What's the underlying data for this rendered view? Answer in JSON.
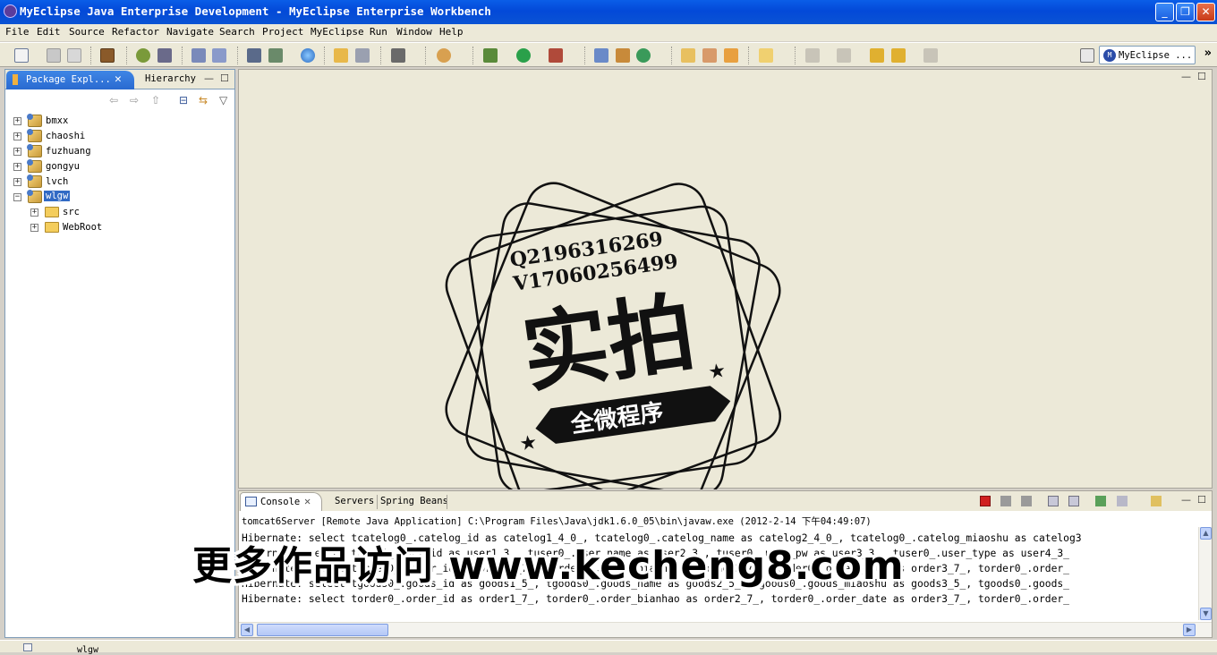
{
  "window": {
    "title": "MyEclipse Java Enterprise Development - MyEclipse Enterprise Workbench",
    "minimize": "_",
    "restore": "❐",
    "close": "✕"
  },
  "menu": [
    "File",
    "Edit",
    "Source",
    "Refactor",
    "Navigate",
    "Search",
    "Project",
    "MyEclipse",
    "Run",
    "Window",
    "Help"
  ],
  "perspective": {
    "label": "MyEclipse ...",
    "icon": "M",
    "overflow": "»"
  },
  "package_explorer": {
    "tab_label": "Package Expl...",
    "tab_close": "✕",
    "hierarchy_label": "Hierarchy",
    "minimize": "—",
    "maximize": "☐",
    "nav_icons": {
      "back": "⇦",
      "forward": "⇨",
      "up": "⇧",
      "collapse": "⊟",
      "link": "⇆",
      "menu": "▽"
    },
    "tree": [
      {
        "label": "bmxx",
        "type": "project",
        "expander": "+"
      },
      {
        "label": "chaoshi",
        "type": "project",
        "expander": "+"
      },
      {
        "label": "fuzhuang",
        "type": "project",
        "expander": "+"
      },
      {
        "label": "gongyu",
        "type": "project",
        "expander": "+"
      },
      {
        "label": "lvch",
        "type": "project",
        "expander": "+"
      },
      {
        "label": "wlgw",
        "type": "project",
        "expander": "−",
        "selected": true
      },
      {
        "label": "src",
        "type": "folder",
        "expander": "+"
      },
      {
        "label": "WebRoot",
        "type": "folder",
        "expander": "+"
      }
    ]
  },
  "editor": {
    "minimize": "—",
    "maximize": "☐"
  },
  "stamp": {
    "line1": "Q2196316269",
    "line2": "V17060256499",
    "main": "实拍",
    "banner": "全微程序"
  },
  "console": {
    "tabs": [
      "Console",
      "Servers",
      "Spring Beans"
    ],
    "tab_close": "✕",
    "minimize": "—",
    "maximize": "☐",
    "process": "tomcat6Server [Remote Java Application] C:\\Program Files\\Java\\jdk1.6.0_05\\bin\\javaw.exe (2012-2-14 下午04:49:07)",
    "lines": [
      "Hibernate: select tcatelog0_.catelog_id as catelog1_4_0_, tcatelog0_.catelog_name as catelog2_4_0_, tcatelog0_.catelog_miaoshu as catelog3",
      "Hibernate: select tuser0_.user_id as user1_3_, tuser0_.user_name as user2_3_, tuser0_.user_pw as user3_3_, tuser0_.user_type as user4_3_",
      "Hibernate: select torder0_.order_id as order1_7_, torder0_.order_bianhao as order2_7_, torder0_.order_date as order3_7_, torder0_.order_",
      "Hibernate: select tgoods0_.goods_id as goods1_5_, tgoods0_.goods_name as goods2_5_, tgoods0_.goods_miaoshu as goods3_5_, tgoods0_.goods_",
      "Hibernate: select torder0_.order_id as order1_7_, torder0_.order_bianhao as order2_7_, torder0_.order_date as order3_7_, torder0_.order_"
    ]
  },
  "watermark": "更多作品访问 www.kecheng8.com",
  "status": {
    "text": "wlgw"
  }
}
